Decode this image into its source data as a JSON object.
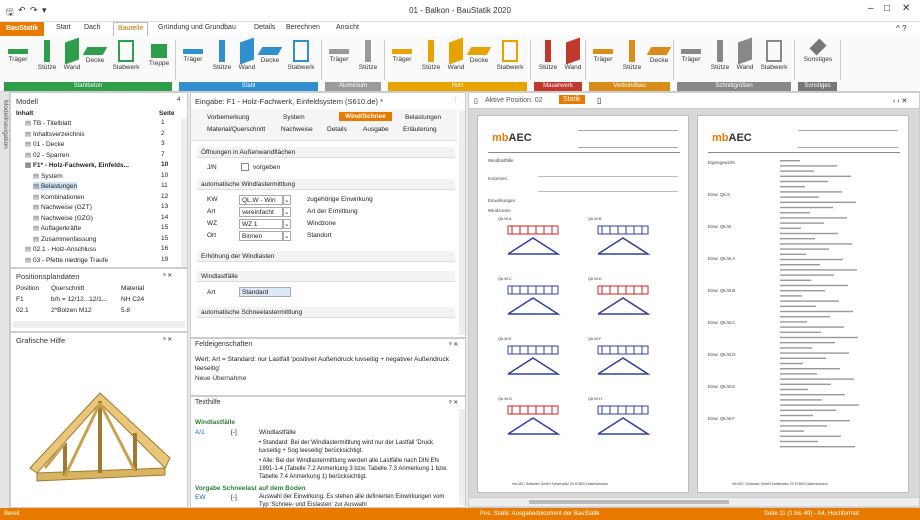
{
  "window": {
    "title": "01 - Balkon - BauStatik 2020",
    "min": "–",
    "max": "□",
    "close": "✕",
    "help": "^ ?"
  },
  "ribbon_tabs": [
    "BauStatik",
    "Start",
    "Dach",
    "Bauteile",
    "Gründung und Grundbau",
    "Details",
    "Berechnen",
    "Ansicht"
  ],
  "ribbon_groups": [
    {
      "label": "Stahlbeton",
      "buttons": [
        "Träger",
        "Stütze",
        "Wand",
        "Decke",
        "Stabwerk",
        "Treppe"
      ]
    },
    {
      "label": "Stahl",
      "buttons": [
        "Träger",
        "Stütze",
        "Wand",
        "Decke",
        "Stabwerk"
      ]
    },
    {
      "label": "Aluminium",
      "buttons": [
        "Träger",
        "Stütze"
      ]
    },
    {
      "label": "Holz",
      "buttons": [
        "Träger",
        "Stütze",
        "Wand",
        "Decke",
        "Stabwerk"
      ]
    },
    {
      "label": "Mauerwerk",
      "buttons": [
        "Stütze",
        "Wand"
      ]
    },
    {
      "label": "Verbundbau",
      "buttons": [
        "Träger",
        "Stütze",
        "Decke"
      ]
    },
    {
      "label": "Schnittgrößen",
      "buttons": [
        "Träger",
        "Stütze",
        "Wand",
        "Stabwerk"
      ]
    },
    {
      "label": "Sonstiges",
      "buttons": [
        "Sonstiges"
      ]
    }
  ],
  "side_tab": "Modellnavigation",
  "model": {
    "title": "Modell",
    "pin": "4",
    "col_inhalt": "Inhalt",
    "col_seite": "Seite",
    "rows": [
      {
        "label": "TB - Titelblatt",
        "page": "1"
      },
      {
        "label": "Inhaltsverzeichnis",
        "page": "2"
      },
      {
        "label": "01 - Decke",
        "page": "3"
      },
      {
        "label": "02 - Sparren",
        "page": "7"
      },
      {
        "label": "F1* - Holz-Fachwerk, Einfelds...",
        "page": "10"
      },
      {
        "label": "System",
        "page": "10"
      },
      {
        "label": "Belastungen",
        "page": "11"
      },
      {
        "label": "Kombinationen",
        "page": "12"
      },
      {
        "label": "Nachweise (GZT)",
        "page": "13"
      },
      {
        "label": "Nachweise (GZG)",
        "page": "14"
      },
      {
        "label": "Auflagerkräfte",
        "page": "15"
      },
      {
        "label": "Zusammenfassung",
        "page": "15"
      },
      {
        "label": "02.1 - Holz-Anschluss",
        "page": "16"
      },
      {
        "label": "03 - Pfette niedrige Traufe",
        "page": "19"
      }
    ]
  },
  "positionsplan": {
    "title": "Positionsplandaten",
    "cols": [
      "Position",
      "Querschnitt",
      "Material"
    ],
    "rows": [
      [
        "F1",
        "b/h = 12/12...12/1...",
        "NH C24"
      ],
      [
        "02.1",
        "2*Bolzen M12",
        "5.8"
      ]
    ]
  },
  "grafik": {
    "title": "Grafische Hilfe"
  },
  "eingabe": {
    "title": "Eingabe: F1 - Holz-Fachwerk, Einfeldsystem (S610.de) *",
    "tabs_row1": [
      "Vorbemerkung",
      "System",
      "Wind/Schnee",
      "Belastungen"
    ],
    "tabs_row2": [
      "Material/Querschnitt",
      "Nachweise",
      "Details",
      "Ausgabe",
      "Erläuterung"
    ],
    "s1": "Öffnungen in Außenwandflächen",
    "jn": "J/N",
    "vorgeben": "vorgeben",
    "s2": "automatische Windlastermittlung",
    "fields": [
      {
        "key": "KW",
        "value": "QL.W - Win",
        "desc": "zugehörige Einwirkung"
      },
      {
        "key": "Art",
        "value": "vereinfacht",
        "desc": "Art der Ermittlung"
      },
      {
        "key": "WZ",
        "value": "WZ 1",
        "desc": "Windzone"
      },
      {
        "key": "Ort",
        "value": "Binnen",
        "desc": "Standort"
      }
    ],
    "s3": "Erhöhung der Windlasten",
    "s4": "Windlastfälle",
    "art": "Art",
    "art_value": "Standard",
    "s5": "automatische Schneelastermittlung"
  },
  "feld": {
    "title": "Feldeigenschaften",
    "text": "Wert: Art = Standard: nur Lastfall 'positiver Außendruck luvseitig + negativer Außendruck leeseitig'",
    "link": "Neue Übernahme"
  },
  "texthilfe": {
    "title": "Texthilfe",
    "heading": "Windlastfälle",
    "code": "A/1",
    "bracket": "[-]",
    "label": "Windlastfälle",
    "b1": "Standard: Bei der Windlastermittlung wird nur der Lastfall 'Druck luvseitig + Sog leeseitig' berücksichtigt.",
    "b2": "Alle: Bei der Windlastermittlung werden alle Lastfälle nach DIN EN 1991-1-4 (Tabelle 7.2 Anmerkung 3 bzw. Tabelle 7.3 Anmerkung 1 bzw. Tabelle 7.4 Anmerkung 1) berücksichtigt.",
    "heading2": "Vorgabe Schneelast auf dem Boden",
    "code2": "EW",
    "label2": "Auswahl der Einwirkung. Es stehen alle definierten Einwirkungen vom Typ 'Schnee- und Eislasten' zur Auswahl"
  },
  "preview": {
    "tab_label": "Aktive Position: 02",
    "tab_active": "Statik",
    "nav": "‹ › ✕",
    "page1": {
      "logo_a": "mb",
      "logo_b": "AEC",
      "rows": [
        "Windlastfälle",
        "Kolonnen",
        "Einwirkungen",
        "Windzonen"
      ],
      "diag": [
        "Qk.W.A",
        "Qk.W.B",
        "Qk.W.C",
        "Qk.W.D",
        "Qk.W.E",
        "Qk.W.F",
        "Qk.W.G",
        "Qk.W.H"
      ],
      "footer": "mb AEC Software GmbH    Kaiserpfalz 20    67663 Kaiserslautern"
    },
    "page2": {
      "logo_a": "mb",
      "logo_b": "AEC",
      "rows": [
        "Eigengewicht",
        "Einw. Qk.S",
        "Einw. Qk.W",
        "Einw. Qk.W,A",
        "Einw. Qk.W,B",
        "Einw. Qk.W,C",
        "Einw. Qk.W,D",
        "Einw. Qk.W,E",
        "Einw. Qk.W,F"
      ],
      "footer": "mb AEC Software GmbH    Kaiserpfalz 20    67663 Kaiserslautern"
    }
  },
  "status": {
    "left": "Bereit",
    "center": "Pos. Statik: Ausgabedokument der BauStatik",
    "right": "Seite 11 (1 bis 49) - A4, Hochformat"
  }
}
